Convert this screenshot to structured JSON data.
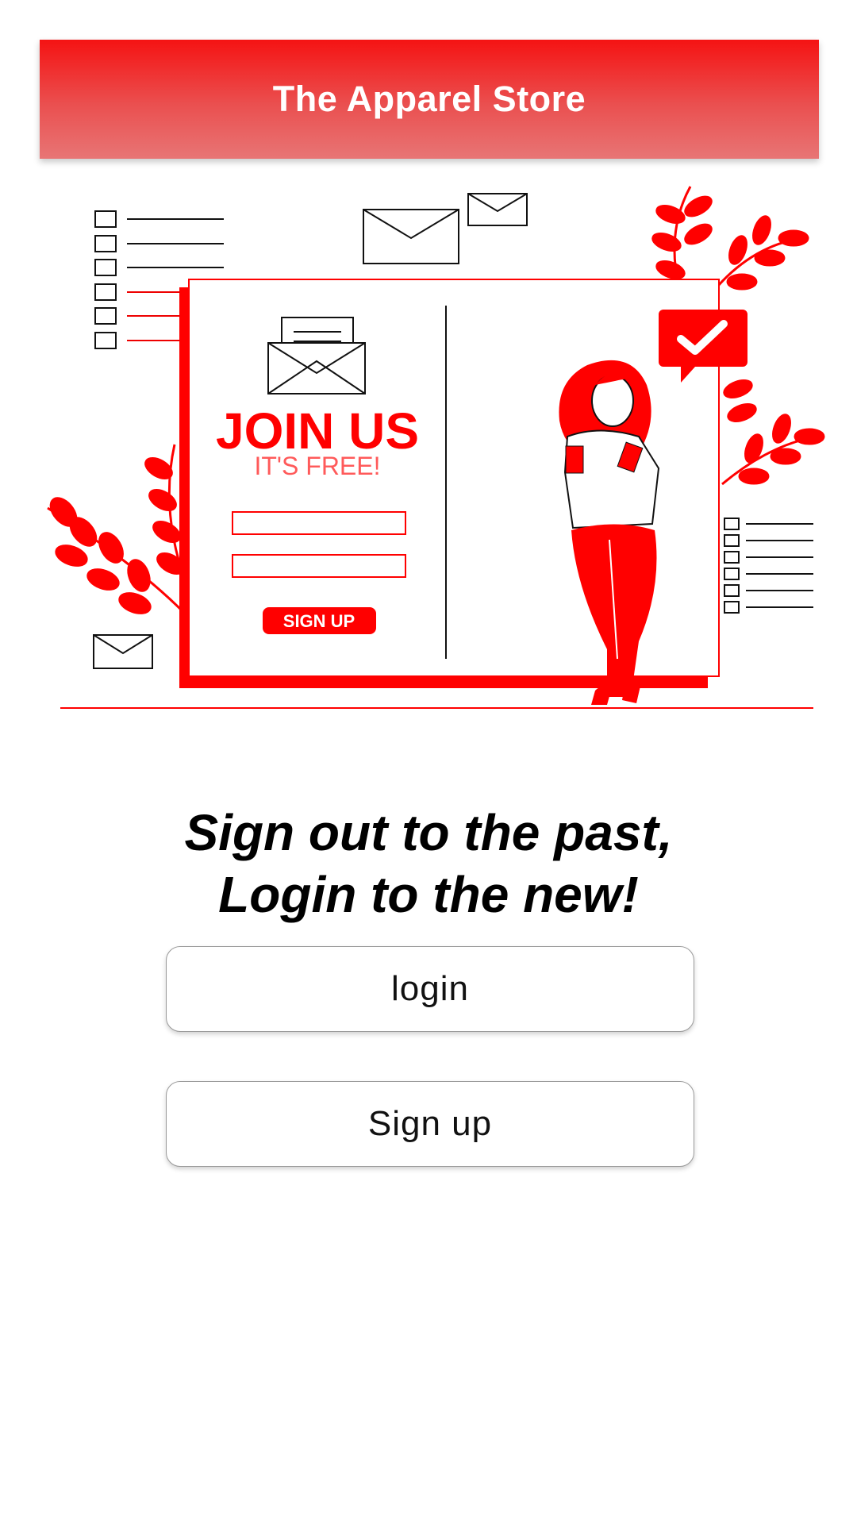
{
  "header": {
    "title": "The Apparel Store"
  },
  "illustration": {
    "heading": "JOIN US",
    "subheading": "IT'S FREE!",
    "button_label": "SIGN UP"
  },
  "tagline": {
    "line1": "Sign out to the past,",
    "line2": "Login to the new!"
  },
  "actions": {
    "login_label": "login",
    "signup_label": "Sign up"
  },
  "colors": {
    "accent": "#ff0000",
    "header_top": "#f51313",
    "header_bottom": "#e87575"
  }
}
